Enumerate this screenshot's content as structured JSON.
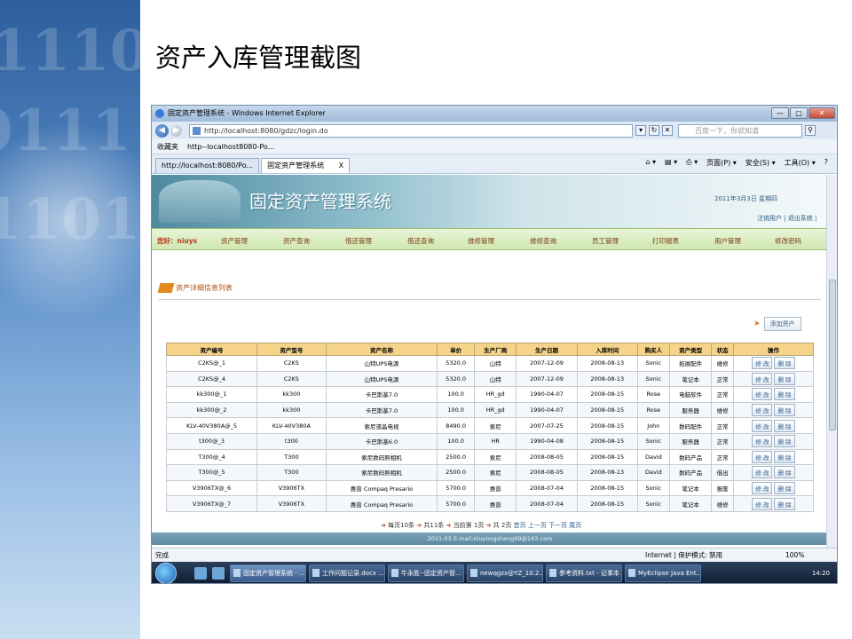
{
  "slide": {
    "title": "资产入库管理截图"
  },
  "browser": {
    "window_title": "固定资产管理系统 - Windows Internet Explorer",
    "window_buttons": [
      "—",
      "▢",
      "✕"
    ],
    "url": "http://localhost:8080/gdzc/login.do",
    "search_placeholder": "百度一下，你就知道",
    "favorites_label": "收藏夹",
    "favorites_link": "http--localhost8080-Po...",
    "tabs": [
      "http://localhost:8080/Po...",
      "固定资产管理系统"
    ],
    "tab_close": "X",
    "tools": [
      "页面(P) ▾",
      "安全(S) ▾",
      "工具(O) ▾",
      "?"
    ],
    "status_text": "完成",
    "zone_text": "Internet | 保护模式: 禁用",
    "zoom_text": "100%"
  },
  "app": {
    "system_name": "固定资产管理系统",
    "date_text": "2011年3月3日   星期四",
    "top_links": "注销用户 | 退出系统 |",
    "greeting": "您好：niuys",
    "menu": [
      "资产管理",
      "资产查询",
      "借还管理",
      "借还查询",
      "维修管理",
      "维修查询",
      "员工管理",
      "打印报表",
      "用户管理",
      "修改密码"
    ],
    "list_title": "资产详细信息列表",
    "add_button": "添加资产",
    "columns": [
      "资产编号",
      "资产型号",
      "资产名称",
      "单价",
      "生产厂商",
      "生产日期",
      "入库时间",
      "购买人",
      "资产类型",
      "状态",
      "操作"
    ],
    "edit_label": "修 改",
    "delete_label": "删 除",
    "rows": [
      [
        "C2KS@_1",
        "C2KS",
        "山特UPS电源",
        "5320.0",
        "山特",
        "2007-12-09",
        "2008-08-13",
        "Sonic",
        "拓展配件",
        "维修"
      ],
      [
        "C2KS@_4",
        "C2KS",
        "山特UPS电源",
        "5320.0",
        "山特",
        "2007-12-09",
        "2008-08-13",
        "Sonic",
        "笔记本",
        "正常"
      ],
      [
        "kk300@_1",
        "kk300",
        "卡巴斯基7.0",
        "100.0",
        "HR_gd",
        "1990-04-07",
        "2008-08-15",
        "Rose",
        "电脑软件",
        "正常"
      ],
      [
        "kk300@_2",
        "kk300",
        "卡巴斯基7.0",
        "100.0",
        "HR_gd",
        "1990-04-07",
        "2008-08-15",
        "Rose",
        "服务器",
        "维修"
      ],
      [
        "KLV-40V380A@_5",
        "KLV-40V380A",
        "索尼液晶电视",
        "8490.0",
        "索尼",
        "2007-07-25",
        "2008-08-15",
        "John",
        "数码配件",
        "正常"
      ],
      [
        "t300@_3",
        "t300",
        "卡巴斯基6.0",
        "100.0",
        "HR",
        "1990-04-08",
        "2008-08-15",
        "Sonic",
        "服务器",
        "正常"
      ],
      [
        "T300@_4",
        "T300",
        "索尼数码照相机",
        "2500.0",
        "索尼",
        "2008-08-05",
        "2008-08-15",
        "David",
        "数码产品",
        "正常"
      ],
      [
        "T300@_5",
        "T300",
        "索尼数码照相机",
        "2500.0",
        "索尼",
        "2008-08-05",
        "2008-08-13",
        "David",
        "数码产品",
        "借出"
      ],
      [
        "V3906TX@_6",
        "V3906TX",
        "惠普 Compaq Presario",
        "5700.0",
        "惠普",
        "2008-07-04",
        "2008-08-15",
        "Sonic",
        "笔记本",
        "报废"
      ],
      [
        "V3906TX@_7",
        "V3906TX",
        "惠普 Compaq Presario",
        "5700.0",
        "惠普",
        "2008-07-04",
        "2008-08-15",
        "Sonic",
        "笔记本",
        "维修"
      ]
    ],
    "pager": {
      "per_page": "每页10条",
      "total": "共11条",
      "current": "当前第 1页",
      "pages": "共 2页",
      "first": "首页",
      "prev": "上一页",
      "next": "下一页",
      "last": "尾页"
    },
    "footer": "2011-03 E-mail:niuyongsheng99@163.com"
  },
  "taskbar": {
    "items": [
      "固定资产管理系统 - ...",
      "工作问题记录.docx ...",
      "牛永胜--固定资产管...",
      "newqgzx@YZ_10.2...",
      "参考资料.txt - 记事本",
      "MyEclipse Java Ent..."
    ],
    "clock": "14:20"
  },
  "colors": {
    "menu_bg": "#cfe7b0",
    "table_header": "#f5d48a",
    "footer_bg": "#5f8aa2"
  }
}
